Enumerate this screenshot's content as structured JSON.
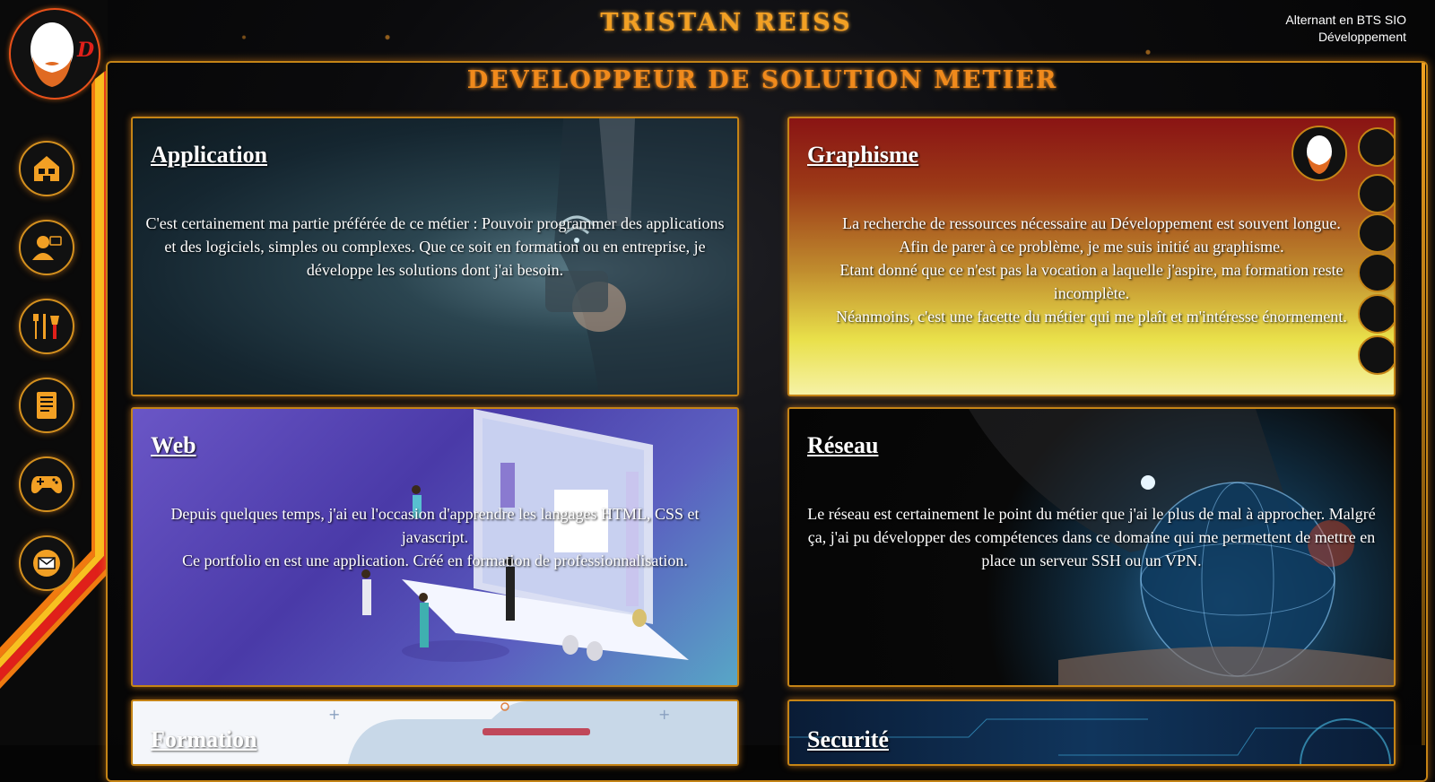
{
  "header": {
    "title": "TRISTAN REISS",
    "meta_line1": "Alternant en BTS SIO",
    "meta_line2": "Développement"
  },
  "page": {
    "title": "DEVELOPPEUR DE SOLUTION METIER"
  },
  "nav": [
    {
      "icon": "home-icon"
    },
    {
      "icon": "profile-icon"
    },
    {
      "icon": "food-icon"
    },
    {
      "icon": "document-icon"
    },
    {
      "icon": "gamepad-icon"
    },
    {
      "icon": "mail-icon"
    }
  ],
  "cards": {
    "application": {
      "title": "Application",
      "lines": [
        "C'est certainement ma partie préférée de ce métier : Pouvoir programmer des applications et des logiciels, simples ou complexes. Que ce soit en formation ou en entreprise, je développe les solutions dont j'ai besoin."
      ]
    },
    "graphisme": {
      "title": "Graphisme",
      "lines": [
        "La recherche de ressources nécessaire au Développement est souvent longue.",
        "Afin de parer à ce problème, je me suis initié au graphisme.",
        "Etant donné que ce n'est pas la vocation a laquelle j'aspire, ma formation reste incomplète.",
        "Néanmoins, c'est une facette du métier qui me plaît et m'intéresse énormement."
      ]
    },
    "web": {
      "title": "Web",
      "lines": [
        "Depuis quelques temps, j'ai eu l'occasion d'apprendre les langages HTML, CSS et javascript.",
        "Ce portfolio en est une application. Créé en formation de professionnalisation."
      ]
    },
    "reseau": {
      "title": "Réseau",
      "lines": [
        "Le réseau est certainement le point du métier que j'ai le plus de mal à approcher. Malgré ça, j'ai pu développer des compétences dans ce domaine qui me permettent de mettre en place un serveur SSH ou un VPN."
      ]
    },
    "formation": {
      "title": "Formation"
    },
    "securite": {
      "title": "Securité"
    }
  },
  "colors": {
    "accent": "#f2a024",
    "border": "#c58416",
    "stripe_red": "#e0201a",
    "stripe_orange": "#f07a10",
    "stripe_yellow": "#f8c020"
  }
}
